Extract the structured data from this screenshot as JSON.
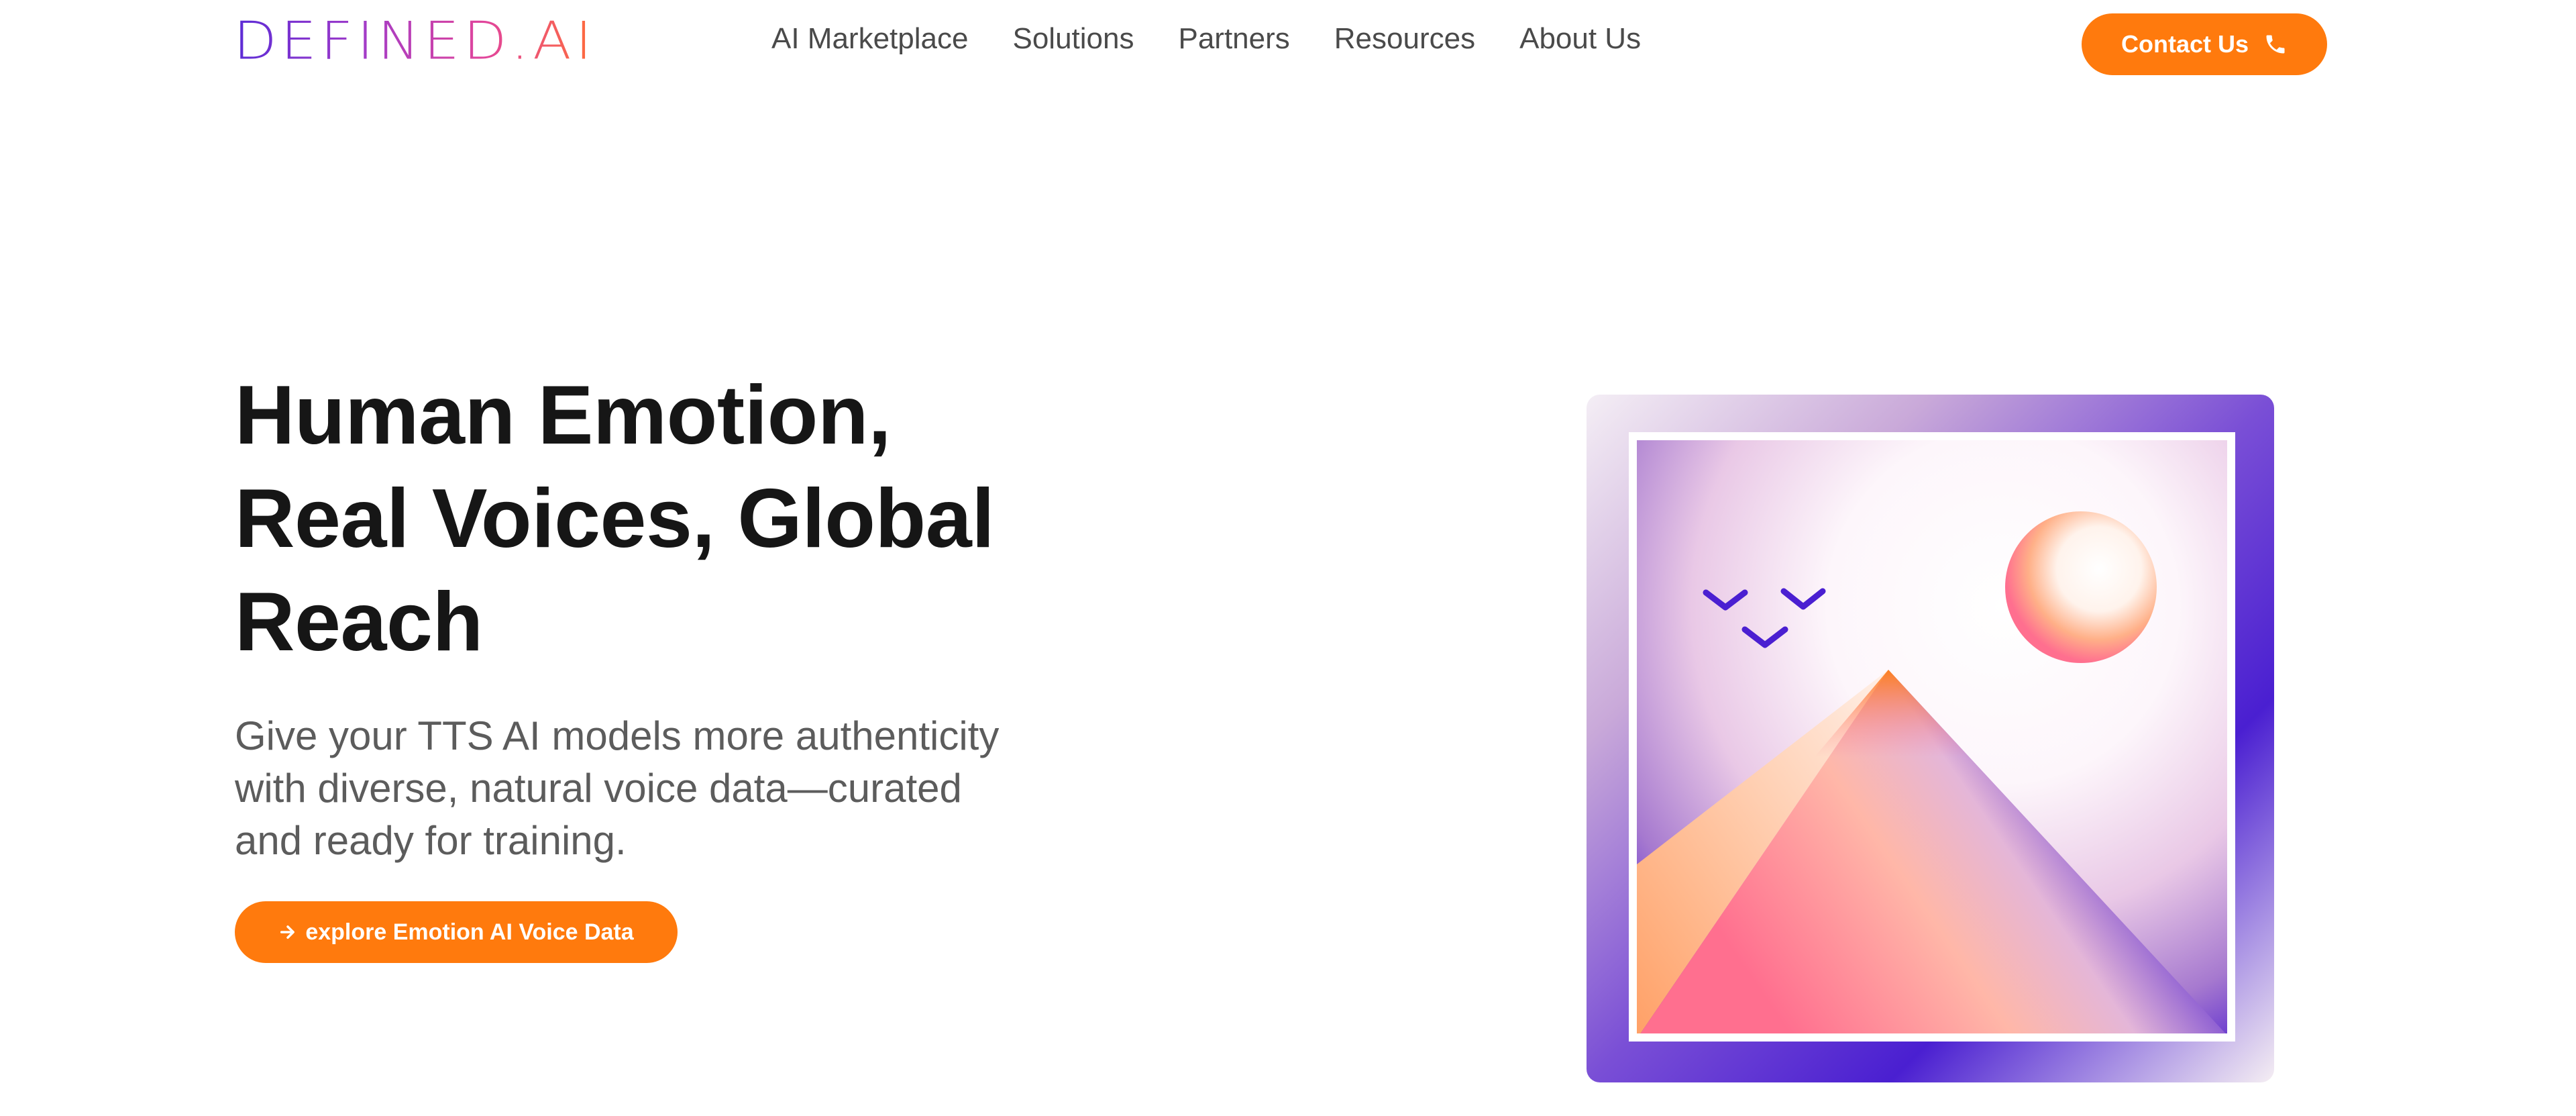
{
  "brand": {
    "logo_text": "DEFINED.AI"
  },
  "nav": {
    "items": [
      {
        "label": "AI Marketplace"
      },
      {
        "label": "Solutions"
      },
      {
        "label": "Partners"
      },
      {
        "label": "Resources"
      },
      {
        "label": "About Us"
      }
    ]
  },
  "header": {
    "contact_label": "Contact Us",
    "contact_icon": "phone-icon"
  },
  "hero": {
    "title_lines": [
      "Human Emotion,",
      "Real Voices, Global",
      "Reach"
    ],
    "subtitle_lines": [
      "Give your TTS AI models more authenticity",
      "with diverse, natural voice data—curated",
      "and ready for training."
    ],
    "cta_label": "explore Emotion AI Voice Data",
    "cta_icon": "arrow-right-icon"
  },
  "illustration": {
    "icons": [
      "bird-icon",
      "sun-icon",
      "mountain-icon"
    ]
  },
  "colors": {
    "accent": "#ff7a0d",
    "brand_purple": "#4a1fd1",
    "brand_pink": "#ff6f8f",
    "text_dark": "#161616",
    "text_muted": "#5c5c5c"
  }
}
